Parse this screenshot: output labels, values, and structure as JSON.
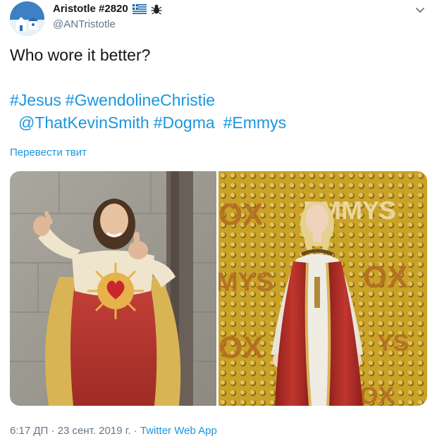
{
  "user": {
    "display_name": "Aristotle #2820",
    "handle": "@ANTristotle"
  },
  "tweet": {
    "text": "Who wore it better?",
    "hashtags_line1": [
      "#Jesus",
      "#GwendolineChristie"
    ],
    "hashtags_line2": [
      "@ThatKevinSmith",
      "#Dogma",
      "#Emmys"
    ],
    "translate_label": "Перевести твит"
  },
  "meta": {
    "time": "6:17 ДП",
    "separator": "·",
    "date": "23 сент. 2019 г.",
    "source": "Twitter Web App"
  },
  "media": {
    "right_photo_backdrop_text": "EMMYS"
  },
  "colors": {
    "link": "#1b95e0",
    "text": "#14171a",
    "secondary": "#657786",
    "emmys_gold": "#c9a227",
    "robe_red": "#b8322b"
  },
  "icons": [
    "greek-flag-icon",
    "bug-icon",
    "chevron-down-icon"
  ]
}
